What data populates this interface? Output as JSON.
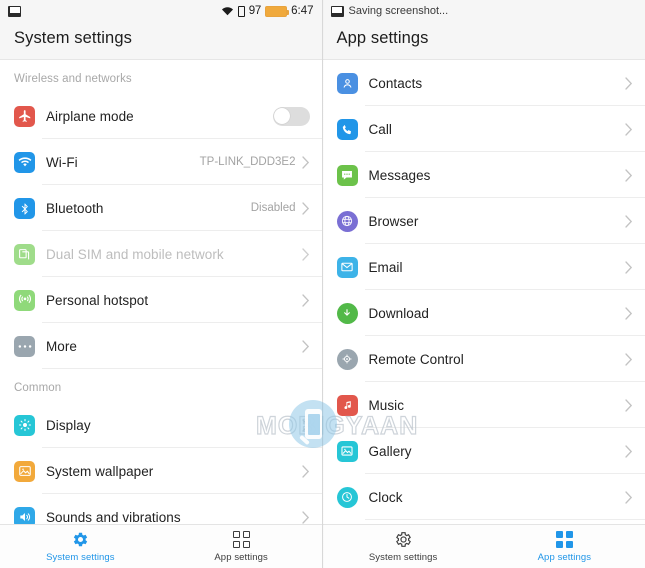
{
  "left_panel": {
    "statusbar": {
      "screenshot_icon": "picture-icon",
      "wifi_icon": "wifi-icon",
      "sim_icon": "sim-card-icon",
      "battery_level": "97",
      "battery_icon": "battery-icon",
      "time": "6:47"
    },
    "header": {
      "title": "System settings"
    },
    "sections": [
      {
        "label": "Wireless and networks",
        "rows": [
          {
            "label": "Airplane mode",
            "icon": "airplane-icon",
            "icon_color": "#e2574c",
            "control": "toggle",
            "toggle_on": false
          },
          {
            "label": "Wi-Fi",
            "icon": "wifi-icon",
            "icon_color": "#2196e8",
            "value": "TP-LINK_DDD3E2",
            "control": "chevron"
          },
          {
            "label": "Bluetooth",
            "icon": "bluetooth-icon",
            "icon_color": "#2196e8",
            "value": "Disabled",
            "control": "chevron"
          },
          {
            "label": "Dual SIM and mobile network",
            "icon": "sim-cards-icon",
            "icon_color": "#6cc24a",
            "control": "chevron",
            "disabled": true
          },
          {
            "label": "Personal hotspot",
            "icon": "hotspot-icon",
            "icon_color": "#6cc24a",
            "control": "chevron"
          },
          {
            "label": "More",
            "icon": "more-dots-icon",
            "icon_color": "#9aa6af",
            "control": "chevron"
          }
        ]
      },
      {
        "label": "Common",
        "rows": [
          {
            "label": "Display",
            "icon": "brightness-icon",
            "icon_color": "#26c6d6",
            "control": "chevron"
          },
          {
            "label": "System wallpaper",
            "icon": "wallpaper-icon",
            "icon_color": "#f2a93b",
            "control": "chevron"
          },
          {
            "label": "Sounds and vibrations",
            "icon": "speaker-icon",
            "icon_color": "#2fa8e8",
            "control": "chevron"
          }
        ]
      }
    ],
    "bottom_nav": [
      {
        "label": "System settings",
        "icon": "gear-filled-icon",
        "active": true
      },
      {
        "label": "App settings",
        "icon": "grid-outline-icon",
        "active": false
      }
    ]
  },
  "right_panel": {
    "statusbar": {
      "screenshot_icon": "picture-icon",
      "notification": "Saving screenshot..."
    },
    "header": {
      "title": "App settings"
    },
    "rows": [
      {
        "label": "Contacts",
        "icon": "contacts-icon",
        "icon_color": "#4a90e2",
        "control": "chevron"
      },
      {
        "label": "Call",
        "icon": "phone-icon",
        "icon_color": "#2196e8",
        "control": "chevron"
      },
      {
        "label": "Messages",
        "icon": "message-bubble-icon",
        "icon_color": "#6cc24a",
        "control": "chevron"
      },
      {
        "label": "Browser",
        "icon": "globe-icon",
        "icon_color": "#7a6fd4",
        "control": "chevron"
      },
      {
        "label": "Email",
        "icon": "envelope-icon",
        "icon_color": "#3db3e8",
        "control": "chevron"
      },
      {
        "label": "Download",
        "icon": "download-arrow-icon",
        "icon_color": "#52b948",
        "control": "chevron"
      },
      {
        "label": "Remote Control",
        "icon": "remote-control-icon",
        "icon_color": "#9aa6af",
        "control": "chevron"
      },
      {
        "label": "Music",
        "icon": "music-note-icon",
        "icon_color": "#e2574c",
        "control": "chevron"
      },
      {
        "label": "Gallery",
        "icon": "gallery-icon",
        "icon_color": "#26c6d6",
        "control": "chevron"
      },
      {
        "label": "Clock",
        "icon": "clock-icon",
        "icon_color": "#26c6d6",
        "control": "chevron"
      }
    ],
    "bottom_nav": [
      {
        "label": "System settings",
        "icon": "gear-outline-icon",
        "active": false
      },
      {
        "label": "App settings",
        "icon": "grid-filled-icon",
        "active": true
      }
    ]
  },
  "watermark": {
    "text": "MOBIGYAAN"
  },
  "colors": {
    "accent": "#2196e8",
    "text": "#222222",
    "muted": "#a3a3a3",
    "separator": "#ededed"
  }
}
